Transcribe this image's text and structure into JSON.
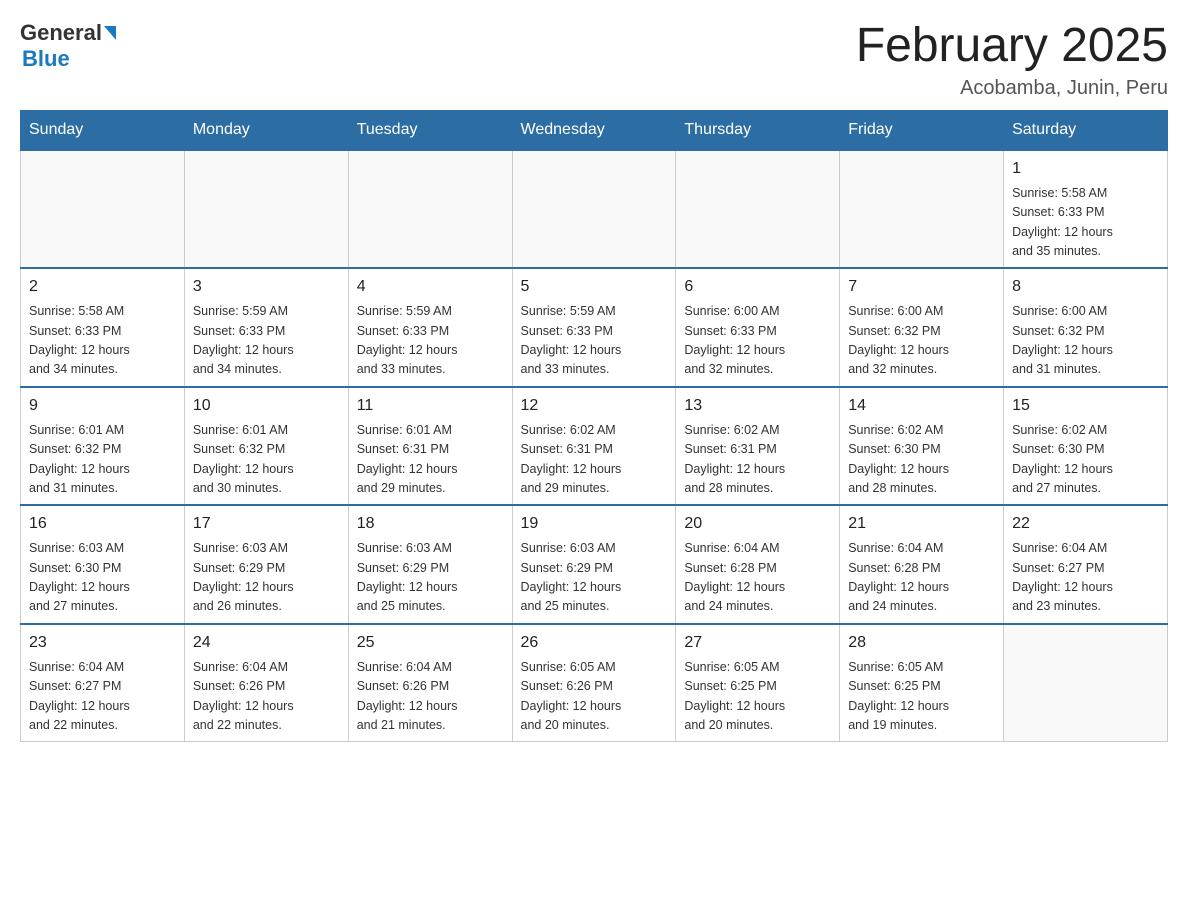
{
  "header": {
    "logo_text1": "General",
    "logo_text2": "Blue",
    "month_title": "February 2025",
    "location": "Acobamba, Junin, Peru"
  },
  "weekdays": [
    "Sunday",
    "Monday",
    "Tuesday",
    "Wednesday",
    "Thursday",
    "Friday",
    "Saturday"
  ],
  "weeks": [
    [
      {
        "day": "",
        "info": ""
      },
      {
        "day": "",
        "info": ""
      },
      {
        "day": "",
        "info": ""
      },
      {
        "day": "",
        "info": ""
      },
      {
        "day": "",
        "info": ""
      },
      {
        "day": "",
        "info": ""
      },
      {
        "day": "1",
        "info": "Sunrise: 5:58 AM\nSunset: 6:33 PM\nDaylight: 12 hours\nand 35 minutes."
      }
    ],
    [
      {
        "day": "2",
        "info": "Sunrise: 5:58 AM\nSunset: 6:33 PM\nDaylight: 12 hours\nand 34 minutes."
      },
      {
        "day": "3",
        "info": "Sunrise: 5:59 AM\nSunset: 6:33 PM\nDaylight: 12 hours\nand 34 minutes."
      },
      {
        "day": "4",
        "info": "Sunrise: 5:59 AM\nSunset: 6:33 PM\nDaylight: 12 hours\nand 33 minutes."
      },
      {
        "day": "5",
        "info": "Sunrise: 5:59 AM\nSunset: 6:33 PM\nDaylight: 12 hours\nand 33 minutes."
      },
      {
        "day": "6",
        "info": "Sunrise: 6:00 AM\nSunset: 6:33 PM\nDaylight: 12 hours\nand 32 minutes."
      },
      {
        "day": "7",
        "info": "Sunrise: 6:00 AM\nSunset: 6:32 PM\nDaylight: 12 hours\nand 32 minutes."
      },
      {
        "day": "8",
        "info": "Sunrise: 6:00 AM\nSunset: 6:32 PM\nDaylight: 12 hours\nand 31 minutes."
      }
    ],
    [
      {
        "day": "9",
        "info": "Sunrise: 6:01 AM\nSunset: 6:32 PM\nDaylight: 12 hours\nand 31 minutes."
      },
      {
        "day": "10",
        "info": "Sunrise: 6:01 AM\nSunset: 6:32 PM\nDaylight: 12 hours\nand 30 minutes."
      },
      {
        "day": "11",
        "info": "Sunrise: 6:01 AM\nSunset: 6:31 PM\nDaylight: 12 hours\nand 29 minutes."
      },
      {
        "day": "12",
        "info": "Sunrise: 6:02 AM\nSunset: 6:31 PM\nDaylight: 12 hours\nand 29 minutes."
      },
      {
        "day": "13",
        "info": "Sunrise: 6:02 AM\nSunset: 6:31 PM\nDaylight: 12 hours\nand 28 minutes."
      },
      {
        "day": "14",
        "info": "Sunrise: 6:02 AM\nSunset: 6:30 PM\nDaylight: 12 hours\nand 28 minutes."
      },
      {
        "day": "15",
        "info": "Sunrise: 6:02 AM\nSunset: 6:30 PM\nDaylight: 12 hours\nand 27 minutes."
      }
    ],
    [
      {
        "day": "16",
        "info": "Sunrise: 6:03 AM\nSunset: 6:30 PM\nDaylight: 12 hours\nand 27 minutes."
      },
      {
        "day": "17",
        "info": "Sunrise: 6:03 AM\nSunset: 6:29 PM\nDaylight: 12 hours\nand 26 minutes."
      },
      {
        "day": "18",
        "info": "Sunrise: 6:03 AM\nSunset: 6:29 PM\nDaylight: 12 hours\nand 25 minutes."
      },
      {
        "day": "19",
        "info": "Sunrise: 6:03 AM\nSunset: 6:29 PM\nDaylight: 12 hours\nand 25 minutes."
      },
      {
        "day": "20",
        "info": "Sunrise: 6:04 AM\nSunset: 6:28 PM\nDaylight: 12 hours\nand 24 minutes."
      },
      {
        "day": "21",
        "info": "Sunrise: 6:04 AM\nSunset: 6:28 PM\nDaylight: 12 hours\nand 24 minutes."
      },
      {
        "day": "22",
        "info": "Sunrise: 6:04 AM\nSunset: 6:27 PM\nDaylight: 12 hours\nand 23 minutes."
      }
    ],
    [
      {
        "day": "23",
        "info": "Sunrise: 6:04 AM\nSunset: 6:27 PM\nDaylight: 12 hours\nand 22 minutes."
      },
      {
        "day": "24",
        "info": "Sunrise: 6:04 AM\nSunset: 6:26 PM\nDaylight: 12 hours\nand 22 minutes."
      },
      {
        "day": "25",
        "info": "Sunrise: 6:04 AM\nSunset: 6:26 PM\nDaylight: 12 hours\nand 21 minutes."
      },
      {
        "day": "26",
        "info": "Sunrise: 6:05 AM\nSunset: 6:26 PM\nDaylight: 12 hours\nand 20 minutes."
      },
      {
        "day": "27",
        "info": "Sunrise: 6:05 AM\nSunset: 6:25 PM\nDaylight: 12 hours\nand 20 minutes."
      },
      {
        "day": "28",
        "info": "Sunrise: 6:05 AM\nSunset: 6:25 PM\nDaylight: 12 hours\nand 19 minutes."
      },
      {
        "day": "",
        "info": ""
      }
    ]
  ]
}
